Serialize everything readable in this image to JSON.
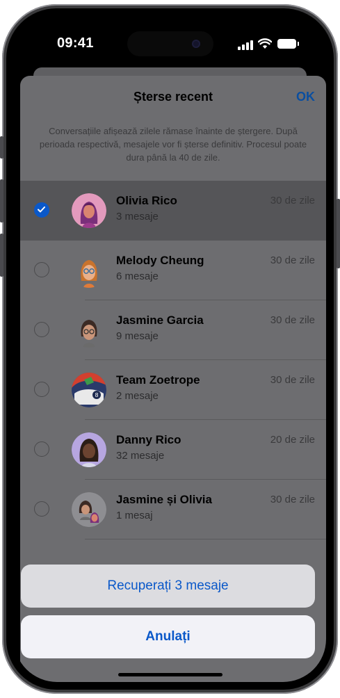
{
  "status_bar": {
    "time": "09:41"
  },
  "sheet": {
    "title": "Șterse recent",
    "done_label": "OK",
    "info_text": "Conversațiile afișează zilele rămase înainte de ștergere. După perioada respectivă, mesajele vor fi șterse definitiv. Procesul poate dura până la 40 de zile."
  },
  "conversations": [
    {
      "name": "Olivia Rico",
      "count": "3 mesaje",
      "days": "30 de zile",
      "selected": true
    },
    {
      "name": "Melody Cheung",
      "count": "6 mesaje",
      "days": "30 de zile",
      "selected": false
    },
    {
      "name": "Jasmine Garcia",
      "count": "9 mesaje",
      "days": "30 de zile",
      "selected": false
    },
    {
      "name": "Team Zoetrope",
      "count": "2 mesaje",
      "days": "30 de zile",
      "selected": false
    },
    {
      "name": "Danny Rico",
      "count": "32 mesaje",
      "days": "20 de zile",
      "selected": false
    },
    {
      "name": "Jasmine și Olivia",
      "count": "1 mesaj",
      "days": "30 de zile",
      "selected": false
    }
  ],
  "actions": {
    "recover_label": "Recuperați 3 mesaje",
    "cancel_label": "Anulați"
  },
  "colors": {
    "accent": "#0a58c9",
    "selected_row": "#555558",
    "sheet_dimmed": "#6d6d70"
  }
}
